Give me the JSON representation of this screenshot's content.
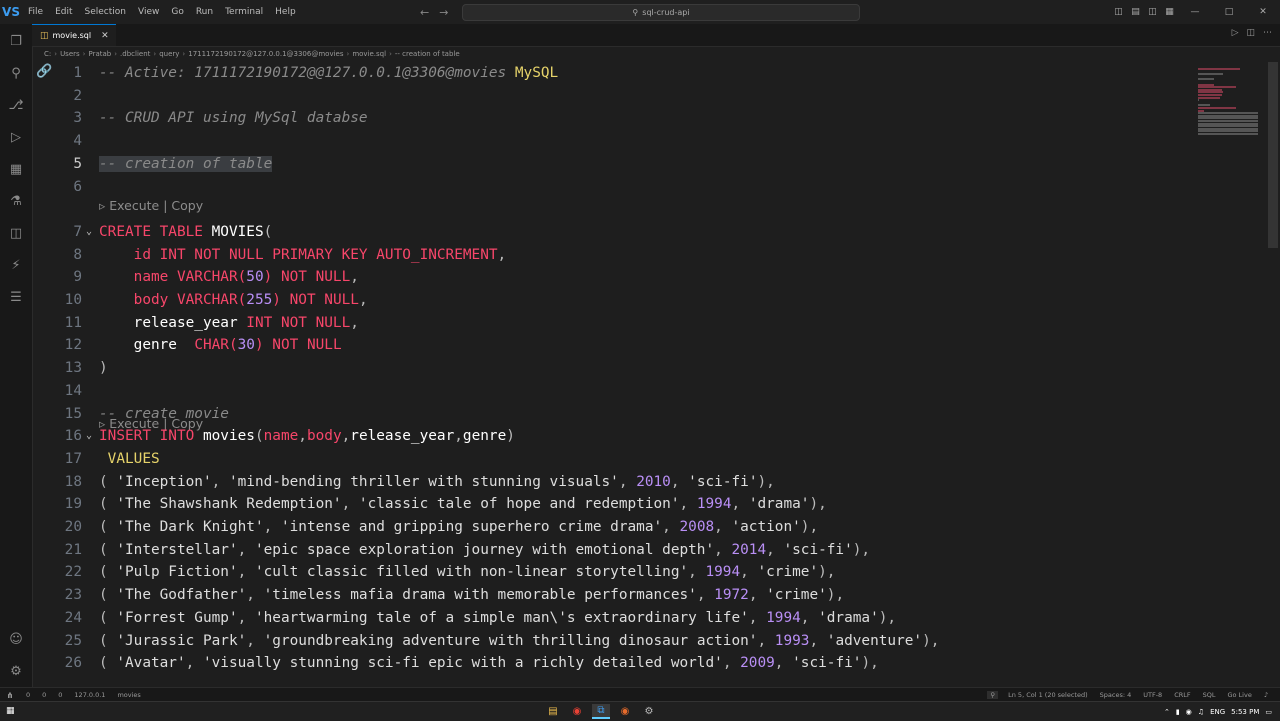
{
  "titlebar": {
    "logo": "VS",
    "menu": [
      "File",
      "Edit",
      "Selection",
      "View",
      "Go",
      "Run",
      "Terminal",
      "Help"
    ],
    "search": "sql-crud-api",
    "search_icon": "search-icon"
  },
  "tab": {
    "label": "movie.sql",
    "icon": "database-icon"
  },
  "breadcrumb": [
    "C:",
    "Users",
    "Pratab",
    ".dbclient",
    "query",
    "1711172190172@127.0.0.1@3306@movies",
    "movie.sql",
    "-- creation of table"
  ],
  "codelens": {
    "execute": "Execute | Copy"
  },
  "lines": [
    {
      "n": "1",
      "segs": [
        [
          "c-com",
          "-- Active: 1711172190172@@127.0.0.1@3306@movies "
        ],
        [
          "c-kw2",
          "MySQL"
        ]
      ]
    },
    {
      "n": "2",
      "segs": []
    },
    {
      "n": "3",
      "segs": [
        [
          "c-com",
          "-- CRUD API using MySql databse"
        ]
      ]
    },
    {
      "n": "4",
      "segs": []
    },
    {
      "n": "5",
      "segs": [
        [
          "c-com sel",
          "-- creation of table"
        ]
      ],
      "active": true
    },
    {
      "n": "6",
      "segs": []
    },
    {
      "n": "7",
      "fold": true,
      "segs": [
        [
          "c-kw",
          "CREATE TABLE "
        ],
        [
          "c-id",
          "MOVIES"
        ],
        [
          "c-op",
          "("
        ]
      ]
    },
    {
      "n": "8",
      "segs": [
        [
          "c-fld",
          "    id INT NOT NULL PRIMARY KEY AUTO_INCREMENT"
        ],
        [
          "c-op",
          ","
        ]
      ]
    },
    {
      "n": "9",
      "segs": [
        [
          "c-fld",
          "    name VARCHAR("
        ],
        [
          "c-num",
          "50"
        ],
        [
          "c-fld",
          ") NOT NULL"
        ],
        [
          "c-op",
          ","
        ]
      ]
    },
    {
      "n": "10",
      "segs": [
        [
          "c-fld",
          "    body VARCHAR("
        ],
        [
          "c-num",
          "255"
        ],
        [
          "c-fld",
          ") NOT NULL"
        ],
        [
          "c-op",
          ","
        ]
      ]
    },
    {
      "n": "11",
      "segs": [
        [
          "c-id",
          "    release_year "
        ],
        [
          "c-fld",
          "INT NOT NULL"
        ],
        [
          "c-op",
          ","
        ]
      ]
    },
    {
      "n": "12",
      "segs": [
        [
          "c-id",
          "    genre  "
        ],
        [
          "c-fld",
          "CHAR("
        ],
        [
          "c-num",
          "30"
        ],
        [
          "c-fld",
          ") NOT NULL"
        ]
      ]
    },
    {
      "n": "13",
      "segs": [
        [
          "c-op",
          ")"
        ]
      ]
    },
    {
      "n": "14",
      "segs": []
    },
    {
      "n": "15",
      "segs": [
        [
          "c-com",
          "-- create movie"
        ]
      ]
    },
    {
      "n": "16",
      "fold": true,
      "segs": [
        [
          "c-kw",
          "INSERT INTO "
        ],
        [
          "c-id",
          "movies"
        ],
        [
          "c-op",
          "("
        ],
        [
          "c-fld",
          "name"
        ],
        [
          "c-op",
          ","
        ],
        [
          "c-fld",
          "body"
        ],
        [
          "c-op",
          ","
        ],
        [
          "c-id",
          "release_year"
        ],
        [
          "c-op",
          ","
        ],
        [
          "c-id",
          "genre"
        ],
        [
          "c-op",
          ")"
        ]
      ]
    },
    {
      "n": "17",
      "segs": [
        [
          "c-kw2",
          " VALUES"
        ]
      ]
    },
    {
      "n": "18",
      "segs": [
        [
          "c-op",
          "( "
        ],
        [
          "c-str",
          "'Inception'"
        ],
        [
          "c-op",
          ", "
        ],
        [
          "c-str",
          "'mind-bending thriller with stunning visuals'"
        ],
        [
          "c-op",
          ", "
        ],
        [
          "c-num",
          "2010"
        ],
        [
          "c-op",
          ", "
        ],
        [
          "c-str",
          "'sci-fi'"
        ],
        [
          "c-op",
          "),"
        ]
      ]
    },
    {
      "n": "19",
      "segs": [
        [
          "c-op",
          "( "
        ],
        [
          "c-str",
          "'The Shawshank Redemption'"
        ],
        [
          "c-op",
          ", "
        ],
        [
          "c-str",
          "'classic tale of hope and redemption'"
        ],
        [
          "c-op",
          ", "
        ],
        [
          "c-num",
          "1994"
        ],
        [
          "c-op",
          ", "
        ],
        [
          "c-str",
          "'drama'"
        ],
        [
          "c-op",
          "),"
        ]
      ]
    },
    {
      "n": "20",
      "segs": [
        [
          "c-op",
          "( "
        ],
        [
          "c-str",
          "'The Dark Knight'"
        ],
        [
          "c-op",
          ", "
        ],
        [
          "c-str",
          "'intense and gripping superhero crime drama'"
        ],
        [
          "c-op",
          ", "
        ],
        [
          "c-num",
          "2008"
        ],
        [
          "c-op",
          ", "
        ],
        [
          "c-str",
          "'action'"
        ],
        [
          "c-op",
          "),"
        ]
      ]
    },
    {
      "n": "21",
      "segs": [
        [
          "c-op",
          "( "
        ],
        [
          "c-str",
          "'Interstellar'"
        ],
        [
          "c-op",
          ", "
        ],
        [
          "c-str",
          "'epic space exploration journey with emotional depth'"
        ],
        [
          "c-op",
          ", "
        ],
        [
          "c-num",
          "2014"
        ],
        [
          "c-op",
          ", "
        ],
        [
          "c-str",
          "'sci-fi'"
        ],
        [
          "c-op",
          "),"
        ]
      ]
    },
    {
      "n": "22",
      "segs": [
        [
          "c-op",
          "( "
        ],
        [
          "c-str",
          "'Pulp Fiction'"
        ],
        [
          "c-op",
          ", "
        ],
        [
          "c-str",
          "'cult classic filled with non-linear storytelling'"
        ],
        [
          "c-op",
          ", "
        ],
        [
          "c-num",
          "1994"
        ],
        [
          "c-op",
          ", "
        ],
        [
          "c-str",
          "'crime'"
        ],
        [
          "c-op",
          "),"
        ]
      ]
    },
    {
      "n": "23",
      "segs": [
        [
          "c-op",
          "( "
        ],
        [
          "c-str",
          "'The Godfather'"
        ],
        [
          "c-op",
          ", "
        ],
        [
          "c-str",
          "'timeless mafia drama with memorable performances'"
        ],
        [
          "c-op",
          ", "
        ],
        [
          "c-num",
          "1972"
        ],
        [
          "c-op",
          ", "
        ],
        [
          "c-str",
          "'crime'"
        ],
        [
          "c-op",
          "),"
        ]
      ]
    },
    {
      "n": "24",
      "segs": [
        [
          "c-op",
          "( "
        ],
        [
          "c-str",
          "'Forrest Gump'"
        ],
        [
          "c-op",
          ", "
        ],
        [
          "c-str",
          "'heartwarming tale of a simple man\\'s extraordinary life'"
        ],
        [
          "c-op",
          ", "
        ],
        [
          "c-num",
          "1994"
        ],
        [
          "c-op",
          ", "
        ],
        [
          "c-str",
          "'drama'"
        ],
        [
          "c-op",
          "),"
        ]
      ]
    },
    {
      "n": "25",
      "segs": [
        [
          "c-op",
          "( "
        ],
        [
          "c-str",
          "'Jurassic Park'"
        ],
        [
          "c-op",
          ", "
        ],
        [
          "c-str",
          "'groundbreaking adventure with thrilling dinosaur action'"
        ],
        [
          "c-op",
          ", "
        ],
        [
          "c-num",
          "1993"
        ],
        [
          "c-op",
          ", "
        ],
        [
          "c-str",
          "'adventure'"
        ],
        [
          "c-op",
          "),"
        ]
      ]
    },
    {
      "n": "26",
      "segs": [
        [
          "c-op",
          "( "
        ],
        [
          "c-str",
          "'Avatar'"
        ],
        [
          "c-op",
          ", "
        ],
        [
          "c-str",
          "'visually stunning sci-fi epic with a richly detailed world'"
        ],
        [
          "c-op",
          ", "
        ],
        [
          "c-num",
          "2009"
        ],
        [
          "c-op",
          ", "
        ],
        [
          "c-str",
          "'sci-fi'"
        ],
        [
          "c-op",
          "),"
        ]
      ]
    }
  ],
  "statusbar": {
    "left": [
      "0",
      "0",
      "0",
      "127.0.0.1",
      "movies"
    ],
    "right": [
      "Ln 5, Col 1 (20 selected)",
      "Spaces: 4",
      "UTF-8",
      "CRLF",
      "SQL",
      "Go Live"
    ]
  },
  "taskbar": {
    "lang": "ENG",
    "time": "5:53 PM"
  }
}
